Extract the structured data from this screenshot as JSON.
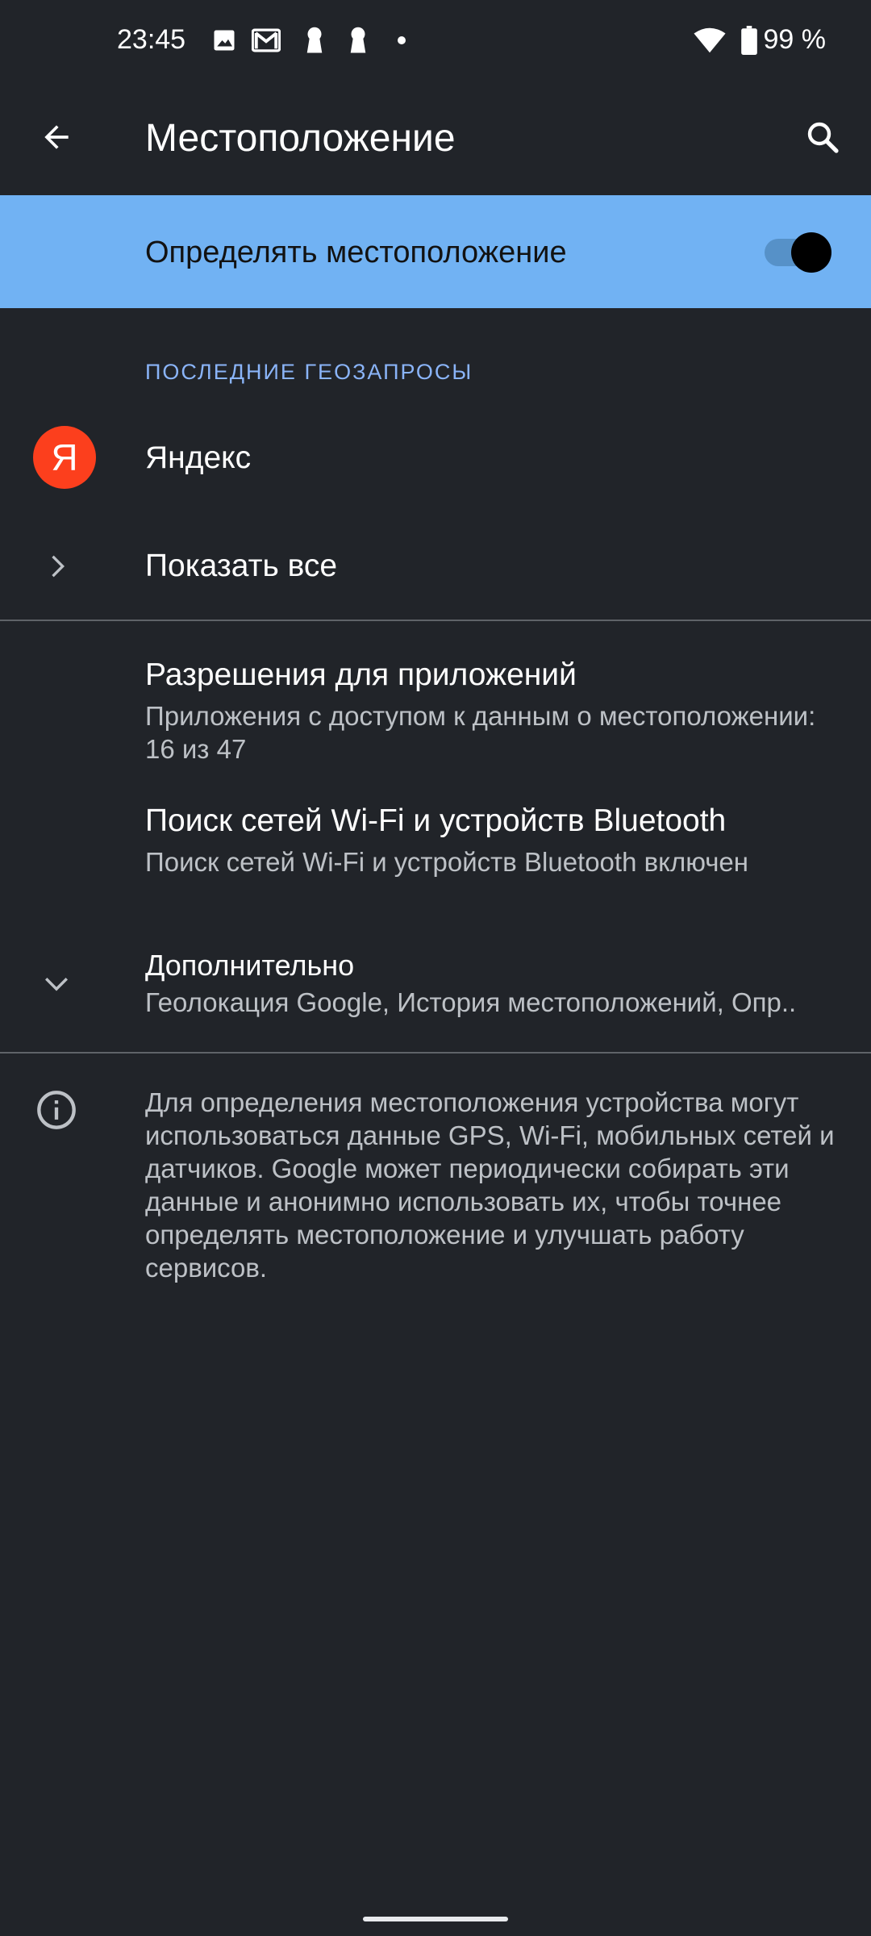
{
  "status_bar": {
    "time": "23:45",
    "battery": "99 %",
    "icons": [
      "image-icon",
      "gmail-icon",
      "keyhole-icon",
      "keyhole-icon",
      "dot-icon",
      "wifi-icon",
      "battery-icon"
    ]
  },
  "toolbar": {
    "title": "Местоположение",
    "back_icon": "arrow-back-icon",
    "search_icon": "search-icon"
  },
  "main_toggle": {
    "label": "Определять местоположение",
    "enabled": true
  },
  "recent": {
    "header": "ПОСЛЕДНИЕ ГЕОЗАПРОСЫ",
    "apps": [
      {
        "name": "Яндекс",
        "icon_letter": "Я"
      }
    ],
    "show_all": "Показать все"
  },
  "settings": [
    {
      "title": "Разрешения для приложений",
      "subtitle": "Приложения с доступом к данным о местоположении: 16 из 47"
    },
    {
      "title": "Поиск сетей Wi-Fi и устройств Bluetooth",
      "subtitle": "Поиск сетей Wi-Fi и устройств Bluetooth включен"
    },
    {
      "title": "Дополнительно",
      "subtitle": "Геолокация Google, История местоположений, Опр.."
    }
  ],
  "info": {
    "text": "Для определения местоположения устройства могут использоваться данные GPS, Wi-Fi, мобильных сетей и датчиков. Google может периодически собирать эти данные и анонимно использовать их, чтобы точнее определять местоположение и улучшать работу сервисов."
  },
  "colors": {
    "background": "#212429",
    "toggle_bar": "#71b2f3",
    "accent": "#8ab4f8",
    "yandex": "#fc3f1d"
  }
}
